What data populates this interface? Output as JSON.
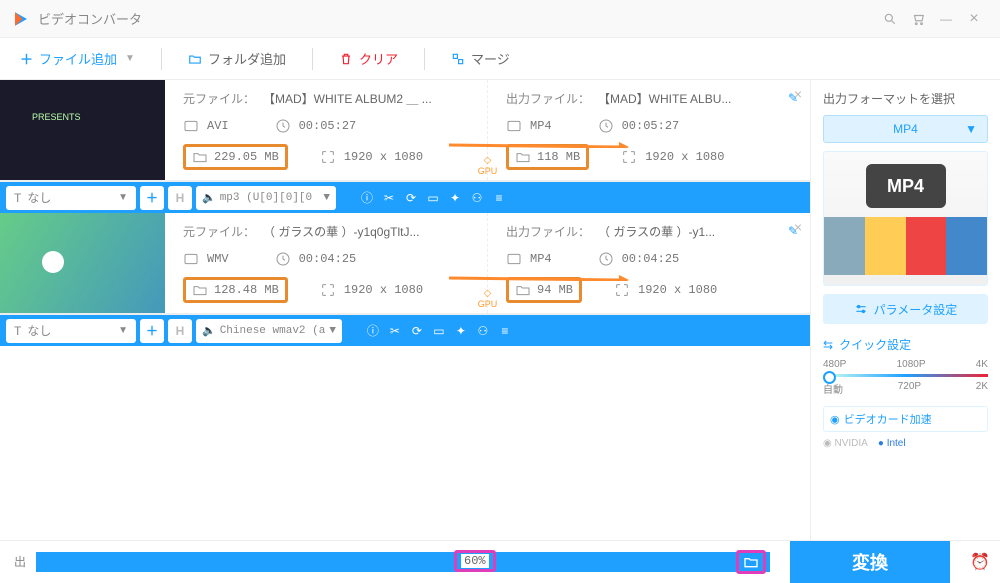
{
  "app_title": "ビデオコンバータ",
  "toolbar": {
    "add_file": "ファイル追加",
    "add_folder": "フォルダ追加",
    "clear": "クリア",
    "merge": "マージ"
  },
  "labels": {
    "src_file": "元ファイル：",
    "out_file": "出力ファイル：",
    "subtitle_none": "なし",
    "output_format_title": "出力フォーマットを選択",
    "param_settings": "パラメータ設定",
    "quick_settings": "クイック設定",
    "gpu_accel": "ビデオカード加速",
    "out_prefix": "出",
    "convert": "変換",
    "auto": "自動"
  },
  "format": {
    "selected": "MP4",
    "badge": "MP4"
  },
  "quick_presets_top": [
    "480P",
    "1080P",
    "4K"
  ],
  "quick_presets_bot": [
    "自動",
    "720P",
    "2K"
  ],
  "vendors": [
    "NVIDIA",
    "Intel"
  ],
  "progress_pct": "60%",
  "files": [
    {
      "src_name": "【MAD】WHITE ALBUM2 ＿ ...",
      "out_name": "【MAD】WHITE ALBU...",
      "src_fmt": "AVI",
      "out_fmt": "MP4",
      "src_dur": "00:05:27",
      "out_dur": "00:05:27",
      "src_size": "229.05 MB",
      "out_size": "118 MB",
      "src_res": "1920 x 1080",
      "out_res": "1920 x 1080",
      "audio": "mp3 (U[0][0][0",
      "gpu_label": "GPU"
    },
    {
      "src_name": "（ ガラスの華 ）-y1q0gTltJ...",
      "out_name": "（ ガラスの華 ）-y1...",
      "src_fmt": "WMV",
      "out_fmt": "MP4",
      "src_dur": "00:04:25",
      "out_dur": "00:04:25",
      "src_size": "128.48 MB",
      "out_size": "94 MB",
      "src_res": "1920 x 1080",
      "out_res": "1920 x 1080",
      "audio": "Chinese wmav2 (a",
      "gpu_label": "GPU"
    }
  ]
}
